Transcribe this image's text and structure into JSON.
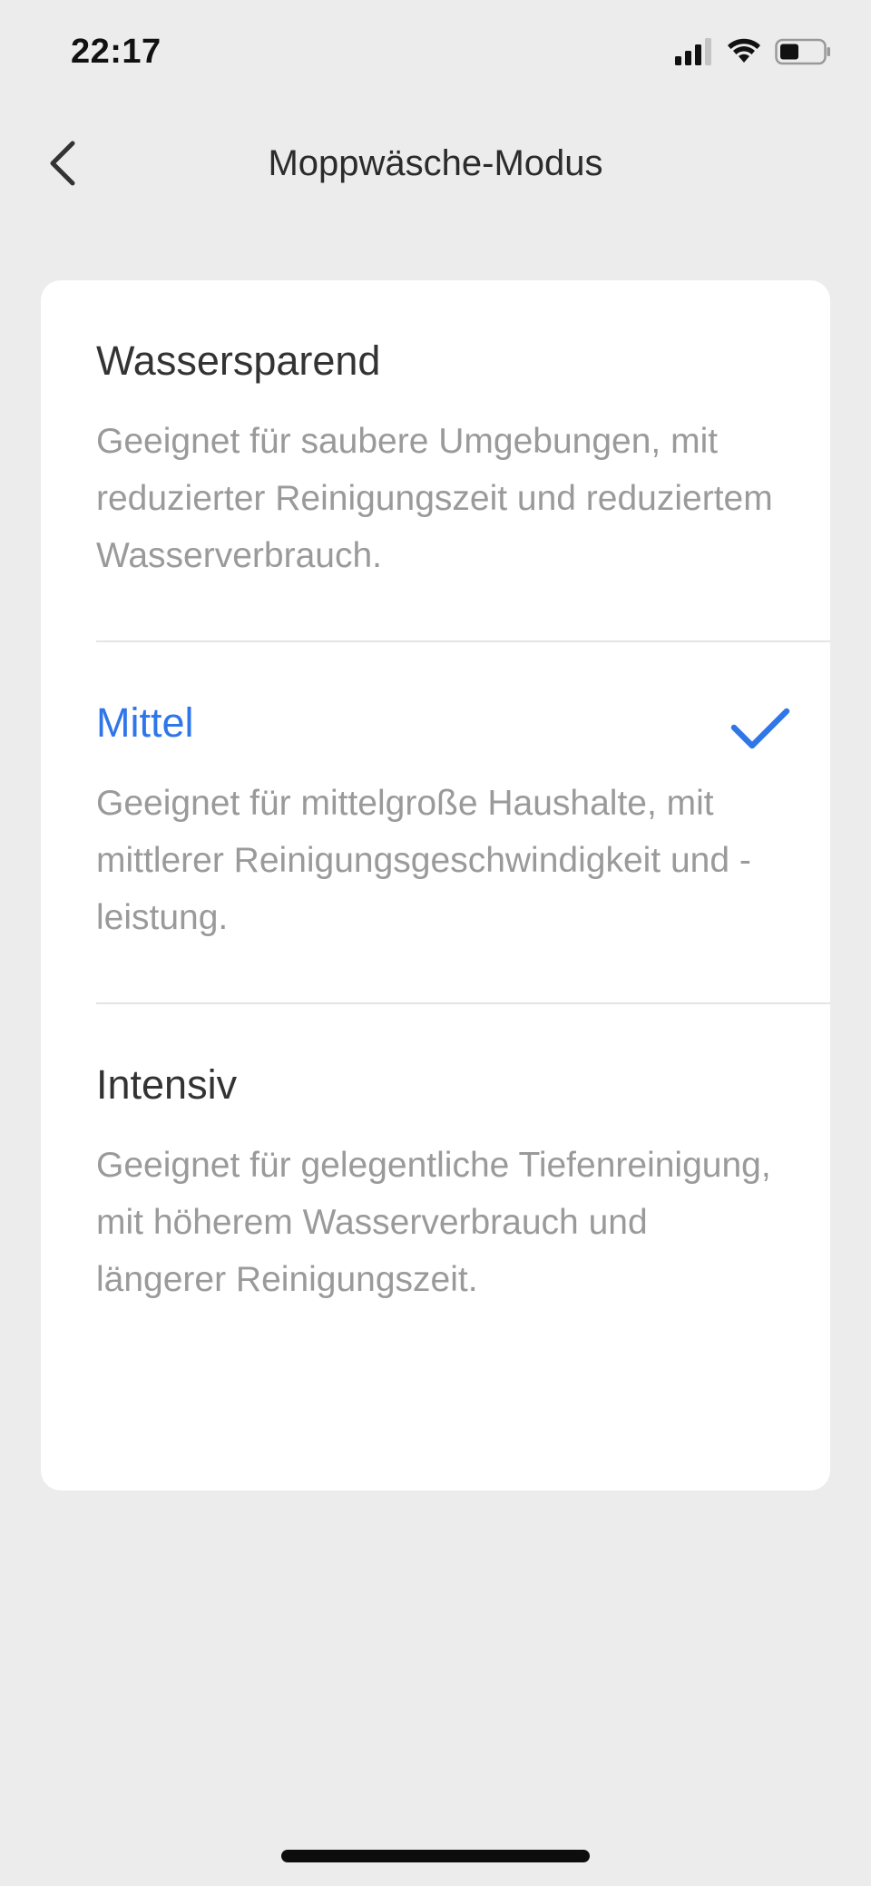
{
  "status_bar": {
    "time": "22:17",
    "icons": [
      "signal-icon",
      "wifi-icon",
      "battery-icon"
    ]
  },
  "header": {
    "back_icon": "chevron-left-icon",
    "title": "Moppwäsche-Modus"
  },
  "options": [
    {
      "title": "Wassersparend",
      "description": "Geeignet für saubere Umgebungen, mit reduzierter Reinigungszeit und reduziertem Wasserverbrauch.",
      "selected": false
    },
    {
      "title": "Mittel",
      "description": "Geeignet für mittelgroße Haushalte, mit mittlerer Reinigungsgeschwindigkeit und -leistung.",
      "selected": true
    },
    {
      "title": "Intensiv",
      "description": "Geeignet für gelegentliche Tiefenreinigung, mit höherem Wasserverbrauch und längerer Reinigungszeit.",
      "selected": false
    }
  ],
  "colors": {
    "accent": "#2f76e8",
    "background": "#ececec",
    "card": "#ffffff"
  }
}
